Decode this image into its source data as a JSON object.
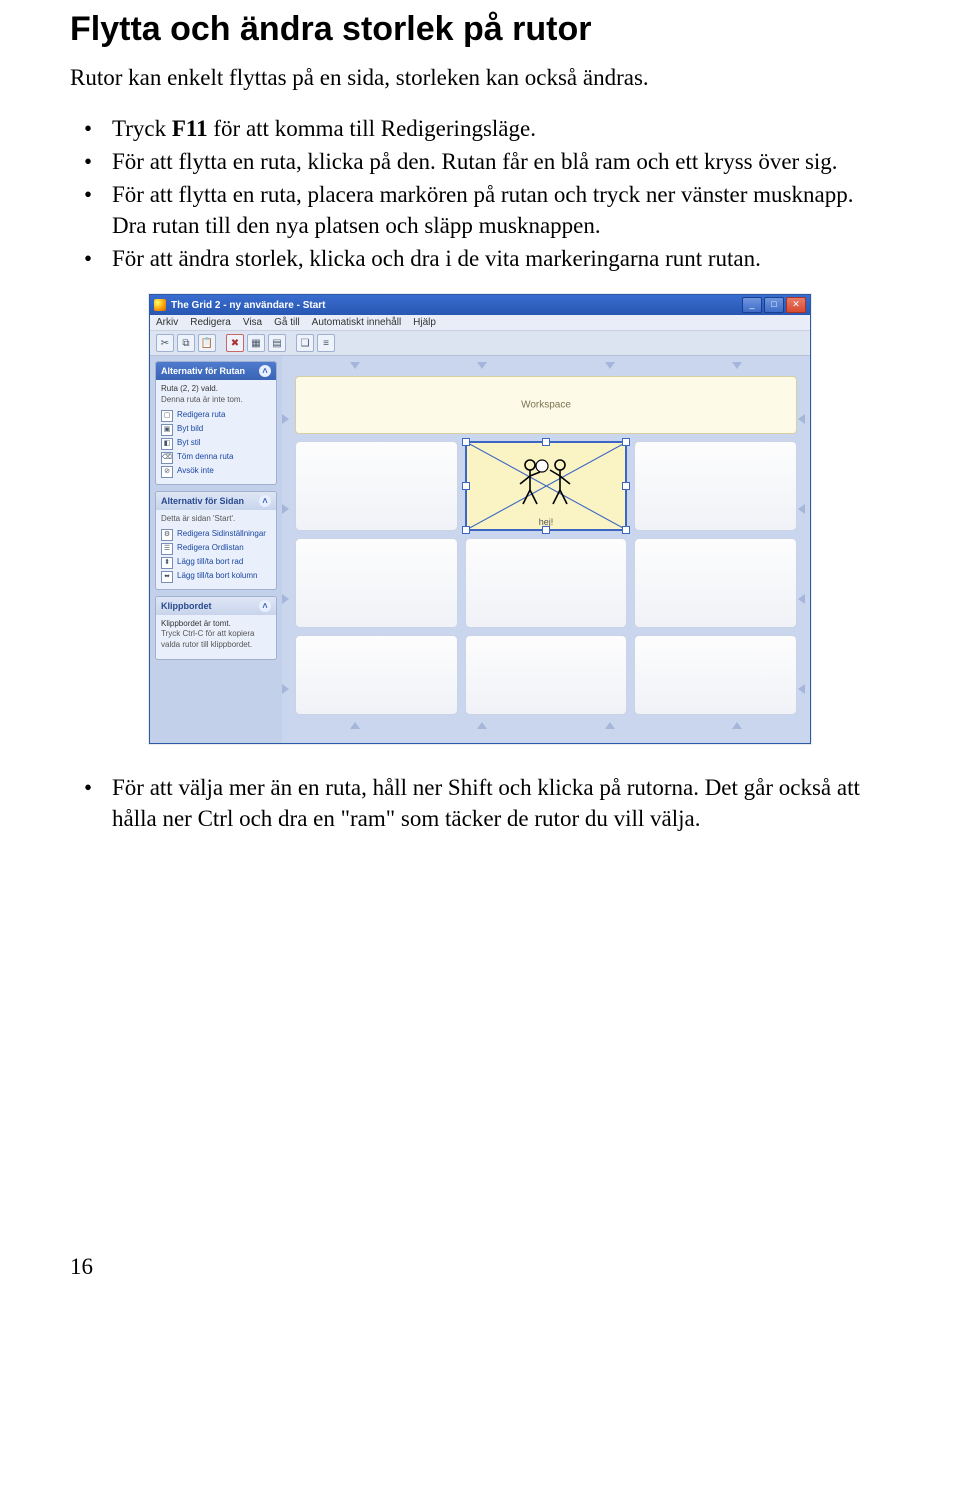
{
  "heading": "Flytta och ändra storlek på rutor",
  "intro": "Rutor kan enkelt flyttas på en sida, storleken kan också ändras.",
  "bullets_top": [
    {
      "pre": "Tryck ",
      "bold": "F11",
      "post": " för att komma till Redigeringsläge."
    },
    {
      "text": "För att flytta en ruta, klicka på den. Rutan får en blå ram och ett kryss över sig."
    },
    {
      "text": "För att flytta en ruta, placera markören på rutan och tryck ner vänster musknapp. Dra rutan till den nya platsen och släpp musknappen."
    },
    {
      "text": "För att ändra storlek, klicka och dra i de vita markeringarna runt rutan."
    }
  ],
  "bullets_bottom": [
    {
      "text": "För att välja mer än en ruta, håll ner Shift och klicka på rutorna. Det går också att hålla ner Ctrl och dra en \"ram\" som täcker de rutor du vill välja."
    }
  ],
  "page_number": "16",
  "app": {
    "title": "The Grid 2 - ny användare - Start",
    "menu": [
      "Arkiv",
      "Redigera",
      "Visa",
      "Gå till",
      "Automatiskt innehåll",
      "Hjälp"
    ],
    "sidebar": {
      "panel1": {
        "title": "Alternativ för Rutan",
        "line1": "Ruta (2, 2) vald.",
        "line2": "Denna ruta är inte tom.",
        "links": [
          "Redigera ruta",
          "Byt bild",
          "Byt stil",
          "Töm denna ruta",
          "Avsök inte"
        ]
      },
      "panel2": {
        "title": "Alternativ för Sidan",
        "line1": "Detta är sidan 'Start'.",
        "links": [
          "Redigera Sidinställningar",
          "Redigera Ordlistan",
          "Lägg till/ta bort rad",
          "Lägg till/ta bort kolumn"
        ]
      },
      "panel3": {
        "title": "Klippbordet",
        "line1": "Klippbordet är tomt.",
        "line2": "Tryck Ctrl-C för att kopiera valda rutor till klippbordet."
      }
    },
    "workspace_label": "Workspace",
    "cell_label": "hej!"
  }
}
